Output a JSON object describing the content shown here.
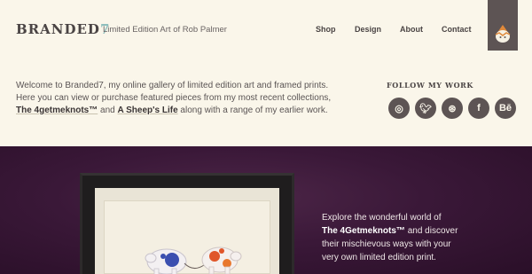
{
  "header": {
    "logo_main": "BRANDED",
    "logo_accent": "7",
    "tagline": "Limited Edition Art of Rob Palmer"
  },
  "nav": {
    "items": [
      {
        "label": "Shop"
      },
      {
        "label": "Design"
      },
      {
        "label": "About"
      },
      {
        "label": "Contact"
      }
    ]
  },
  "intro": {
    "line1": "Welcome to Branded7, my online gallery of limited edition art and framed prints.",
    "line2": "Here you can view or purchase featured pieces from my most recent collections,",
    "link1": "The 4getmeknots™",
    "and": " and ",
    "link2": "A Sheep's Life",
    "tail": " along with a range of my earlier work."
  },
  "follow": {
    "title": "FOLLOW MY WORK",
    "icons": [
      {
        "name": "instagram-icon",
        "glyph": "◎"
      },
      {
        "name": "twitter-icon",
        "glyph": "🐦︎"
      },
      {
        "name": "dribbble-icon",
        "glyph": "⊛"
      },
      {
        "name": "facebook-icon",
        "glyph": "f"
      },
      {
        "name": "behance-icon",
        "glyph": "Bē"
      }
    ]
  },
  "feature": {
    "line1": "Explore the wonderful world of",
    "bold": "The 4Getmeknots™",
    "line2_tail": " and discover",
    "line3": "their mischievous ways with your",
    "line4": "very own limited edition print."
  },
  "colors": {
    "background": "#faf6ea",
    "dark_band": "#3a1838",
    "accent": "#8fbfbd",
    "text": "#4a4444"
  }
}
